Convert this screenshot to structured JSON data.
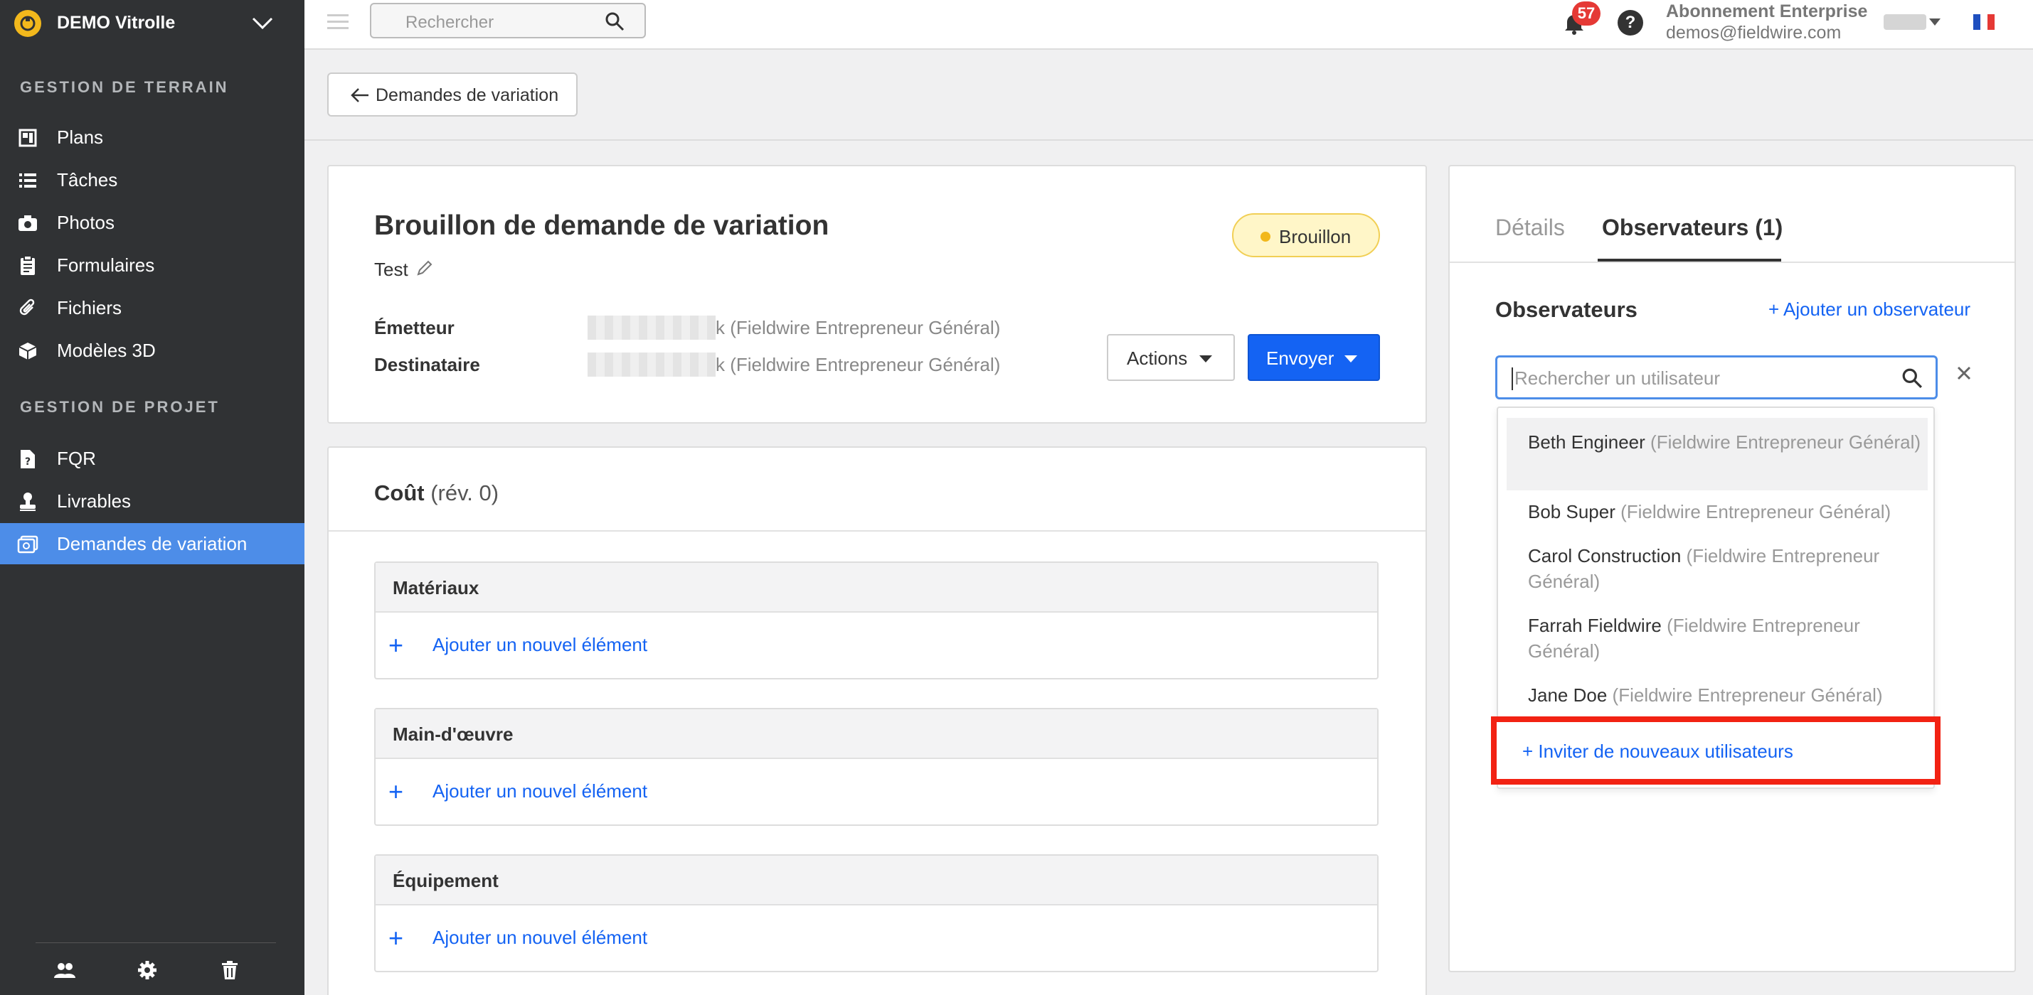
{
  "sidebar": {
    "project_name": "DEMO Vitrolle",
    "sections": [
      {
        "title": "GESTION DE TERRAIN",
        "items": [
          {
            "label": "Plans",
            "icon": "plans-icon"
          },
          {
            "label": "Tâches",
            "icon": "list-icon"
          },
          {
            "label": "Photos",
            "icon": "camera-icon"
          },
          {
            "label": "Formulaires",
            "icon": "clipboard-icon"
          },
          {
            "label": "Fichiers",
            "icon": "paperclip-icon"
          },
          {
            "label": "Modèles 3D",
            "icon": "cube-icon"
          }
        ]
      },
      {
        "title": "GESTION DE PROJET",
        "items": [
          {
            "label": "FQR",
            "icon": "document-question-icon"
          },
          {
            "label": "Livrables",
            "icon": "stamp-icon"
          },
          {
            "label": "Demandes de variation",
            "icon": "change-order-icon",
            "active": true
          }
        ]
      }
    ],
    "active_color": "#4d8de8"
  },
  "topbar": {
    "search_placeholder": "Rechercher",
    "notifications_count": "57",
    "help_label": "?",
    "subscription": "Abonnement Enterprise",
    "email": "demos@fieldwire.com"
  },
  "back_button": {
    "label": "Demandes de variation"
  },
  "header_card": {
    "title": "Brouillon de demande de variation",
    "subtitle": "Test",
    "status": "Brouillon",
    "emitter_label": "Émetteur",
    "emitter_value": "k (Fieldwire Entrepreneur Général)",
    "recipient_label": "Destinataire",
    "recipient_value": "k (Fieldwire Entrepreneur Général)",
    "actions_label": "Actions",
    "send_label": "Envoyer"
  },
  "cost_card": {
    "title": "Coût",
    "revision": "(rév. 0)",
    "sections": [
      {
        "title": "Matériaux",
        "add_label": "Ajouter un nouvel élément"
      },
      {
        "title": "Main-d'œuvre",
        "add_label": "Ajouter un nouvel élément"
      },
      {
        "title": "Équipement",
        "add_label": "Ajouter un nouvel élément"
      }
    ]
  },
  "side_panel": {
    "tabs": [
      {
        "label": "Détails"
      },
      {
        "label": "Observateurs (1)",
        "active": true
      }
    ],
    "observers_title": "Observateurs",
    "add_observer": "+ Ajouter un observateur",
    "search_placeholder": "Rechercher un utilisateur",
    "users": [
      {
        "name": "Beth Engineer",
        "org": "(Fieldwire Entrepreneur Général)"
      },
      {
        "name": "Bob Super",
        "org": "(Fieldwire Entrepreneur Général)"
      },
      {
        "name": "Carol Construction",
        "org": "(Fieldwire Entrepreneur Général)"
      },
      {
        "name": "Farrah Fieldwire",
        "org": "(Fieldwire Entrepreneur Général)"
      },
      {
        "name": "Jane Doe",
        "org": "(Fieldwire Entrepreneur Général)"
      }
    ],
    "invite_label": "+ Inviter de nouveaux utilisateurs",
    "highlight_color": "#f22213"
  },
  "colors": {
    "primary": "#1463f3",
    "sidebar_bg": "#303234",
    "status_bg": "#fff6c8"
  }
}
